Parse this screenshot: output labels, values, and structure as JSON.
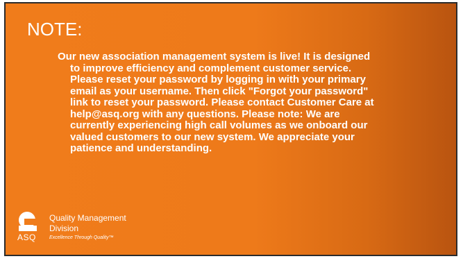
{
  "slide": {
    "title": "NOTE:",
    "message": "Our new association management system is live! It is designed to improve efficiency and complement customer service. Please reset your password by logging in with your primary email as your username. Then click \"Forgot your password\" link to reset your password. Please contact Customer Care at help@asq.org with any questions. Please note: We are currently experiencing high call volumes as we onboard our valued customers to our new system. We appreciate your patience and understanding."
  },
  "logo": {
    "icon": "asq-logo-icon",
    "org": "ASQ",
    "division_line1": "Quality Management",
    "division_line2": "Division",
    "tagline": "Excellence Through Quality™"
  },
  "colors": {
    "background": "#f07c1b",
    "background_dark_edge": "#b95410",
    "text": "#ffffff",
    "border": "#2b2b2b"
  }
}
